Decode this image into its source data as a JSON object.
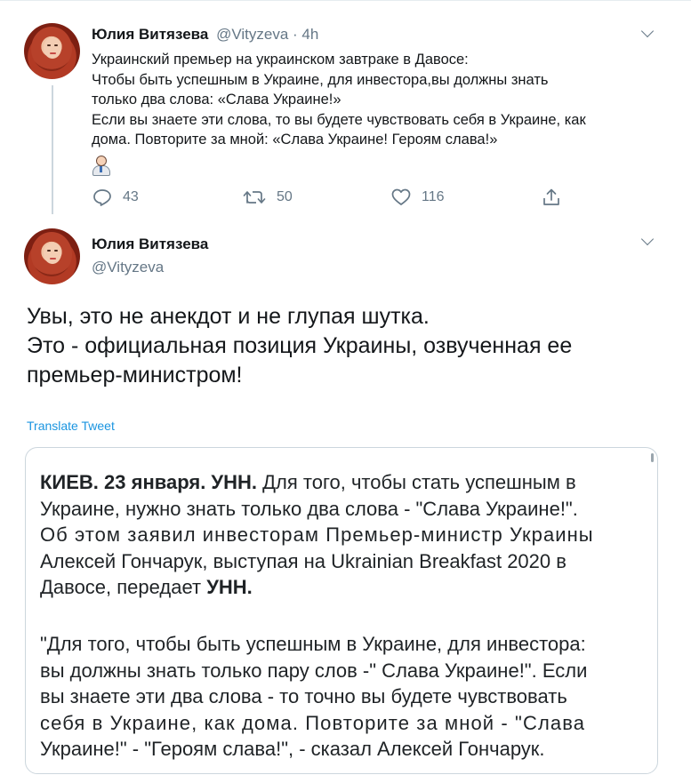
{
  "tweet1": {
    "name": "Юлия Витязева",
    "meta": "@Vityzeva · 4h",
    "lines": [
      "Украинский премьер на украинском завтраке в Давосе:",
      "Чтобы быть успешным в Украине, для инвестора,вы должны знать",
      "только два слова: «Слава Украине!»",
      "Если вы знаете эти слова, то вы будете чувствовать себя в Украине, как",
      "дома. Повторите за мной: «Слава Украине! Героям слава!»"
    ],
    "emoji": "man-office-worker-emoji",
    "actions": {
      "replies": "43",
      "retweets": "50",
      "likes": "116"
    }
  },
  "tweet2": {
    "name": "Юлия Витязева",
    "handle": "@Vityzeva",
    "lines": [
      "Увы, это не анекдот и не глупая шутка.",
      "Это - официальная позиция Украины, озвученная ее",
      "премьер-министром!"
    ],
    "translate": "Translate Tweet"
  },
  "article": {
    "p1_bold_start": "КИЕВ. 23 января. УНН.",
    "p1_line1_rest": "Для того, чтобы стать успешным в",
    "p1_line2": "Украине, нужно знать только два слова - \"Слава Украине!\".",
    "p1_line3": "Об этом заявил инвесторам Премьер-министр Украины",
    "p1_line4": "Алексей Гончарук, выступая на Ukrainian Breakfast 2020 в",
    "p1_line5_start": "Давосе, передает",
    "p1_line5_bold": "УНН.",
    "p2_lines": [
      "\"Для того, чтобы быть успешным в Украине, для инвестора:",
      "вы должны знать только пару слов -\" Слава Украине!\". Если",
      "вы знаете эти два слова - то точно вы будете чувствовать",
      "себя в Украине, как дома. Повторите за мной - \"Слава",
      "Украине!\" - \"Героям слава!\", - сказал Алексей Гончарук."
    ]
  },
  "colors": {
    "link": "#1b95e0",
    "muted": "#657786",
    "text": "#14171a"
  }
}
